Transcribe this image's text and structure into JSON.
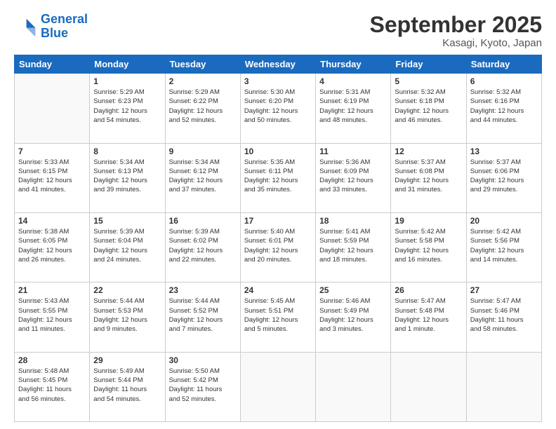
{
  "logo": {
    "line1": "General",
    "line2": "Blue"
  },
  "title": "September 2025",
  "subtitle": "Kasagi, Kyoto, Japan",
  "weekdays": [
    "Sunday",
    "Monday",
    "Tuesday",
    "Wednesday",
    "Thursday",
    "Friday",
    "Saturday"
  ],
  "weeks": [
    [
      {
        "day": "",
        "info": ""
      },
      {
        "day": "1",
        "info": "Sunrise: 5:29 AM\nSunset: 6:23 PM\nDaylight: 12 hours\nand 54 minutes."
      },
      {
        "day": "2",
        "info": "Sunrise: 5:29 AM\nSunset: 6:22 PM\nDaylight: 12 hours\nand 52 minutes."
      },
      {
        "day": "3",
        "info": "Sunrise: 5:30 AM\nSunset: 6:20 PM\nDaylight: 12 hours\nand 50 minutes."
      },
      {
        "day": "4",
        "info": "Sunrise: 5:31 AM\nSunset: 6:19 PM\nDaylight: 12 hours\nand 48 minutes."
      },
      {
        "day": "5",
        "info": "Sunrise: 5:32 AM\nSunset: 6:18 PM\nDaylight: 12 hours\nand 46 minutes."
      },
      {
        "day": "6",
        "info": "Sunrise: 5:32 AM\nSunset: 6:16 PM\nDaylight: 12 hours\nand 44 minutes."
      }
    ],
    [
      {
        "day": "7",
        "info": "Sunrise: 5:33 AM\nSunset: 6:15 PM\nDaylight: 12 hours\nand 41 minutes."
      },
      {
        "day": "8",
        "info": "Sunrise: 5:34 AM\nSunset: 6:13 PM\nDaylight: 12 hours\nand 39 minutes."
      },
      {
        "day": "9",
        "info": "Sunrise: 5:34 AM\nSunset: 6:12 PM\nDaylight: 12 hours\nand 37 minutes."
      },
      {
        "day": "10",
        "info": "Sunrise: 5:35 AM\nSunset: 6:11 PM\nDaylight: 12 hours\nand 35 minutes."
      },
      {
        "day": "11",
        "info": "Sunrise: 5:36 AM\nSunset: 6:09 PM\nDaylight: 12 hours\nand 33 minutes."
      },
      {
        "day": "12",
        "info": "Sunrise: 5:37 AM\nSunset: 6:08 PM\nDaylight: 12 hours\nand 31 minutes."
      },
      {
        "day": "13",
        "info": "Sunrise: 5:37 AM\nSunset: 6:06 PM\nDaylight: 12 hours\nand 29 minutes."
      }
    ],
    [
      {
        "day": "14",
        "info": "Sunrise: 5:38 AM\nSunset: 6:05 PM\nDaylight: 12 hours\nand 26 minutes."
      },
      {
        "day": "15",
        "info": "Sunrise: 5:39 AM\nSunset: 6:04 PM\nDaylight: 12 hours\nand 24 minutes."
      },
      {
        "day": "16",
        "info": "Sunrise: 5:39 AM\nSunset: 6:02 PM\nDaylight: 12 hours\nand 22 minutes."
      },
      {
        "day": "17",
        "info": "Sunrise: 5:40 AM\nSunset: 6:01 PM\nDaylight: 12 hours\nand 20 minutes."
      },
      {
        "day": "18",
        "info": "Sunrise: 5:41 AM\nSunset: 5:59 PM\nDaylight: 12 hours\nand 18 minutes."
      },
      {
        "day": "19",
        "info": "Sunrise: 5:42 AM\nSunset: 5:58 PM\nDaylight: 12 hours\nand 16 minutes."
      },
      {
        "day": "20",
        "info": "Sunrise: 5:42 AM\nSunset: 5:56 PM\nDaylight: 12 hours\nand 14 minutes."
      }
    ],
    [
      {
        "day": "21",
        "info": "Sunrise: 5:43 AM\nSunset: 5:55 PM\nDaylight: 12 hours\nand 11 minutes."
      },
      {
        "day": "22",
        "info": "Sunrise: 5:44 AM\nSunset: 5:53 PM\nDaylight: 12 hours\nand 9 minutes."
      },
      {
        "day": "23",
        "info": "Sunrise: 5:44 AM\nSunset: 5:52 PM\nDaylight: 12 hours\nand 7 minutes."
      },
      {
        "day": "24",
        "info": "Sunrise: 5:45 AM\nSunset: 5:51 PM\nDaylight: 12 hours\nand 5 minutes."
      },
      {
        "day": "25",
        "info": "Sunrise: 5:46 AM\nSunset: 5:49 PM\nDaylight: 12 hours\nand 3 minutes."
      },
      {
        "day": "26",
        "info": "Sunrise: 5:47 AM\nSunset: 5:48 PM\nDaylight: 12 hours\nand 1 minute."
      },
      {
        "day": "27",
        "info": "Sunrise: 5:47 AM\nSunset: 5:46 PM\nDaylight: 11 hours\nand 58 minutes."
      }
    ],
    [
      {
        "day": "28",
        "info": "Sunrise: 5:48 AM\nSunset: 5:45 PM\nDaylight: 11 hours\nand 56 minutes."
      },
      {
        "day": "29",
        "info": "Sunrise: 5:49 AM\nSunset: 5:44 PM\nDaylight: 11 hours\nand 54 minutes."
      },
      {
        "day": "30",
        "info": "Sunrise: 5:50 AM\nSunset: 5:42 PM\nDaylight: 11 hours\nand 52 minutes."
      },
      {
        "day": "",
        "info": ""
      },
      {
        "day": "",
        "info": ""
      },
      {
        "day": "",
        "info": ""
      },
      {
        "day": "",
        "info": ""
      }
    ]
  ]
}
